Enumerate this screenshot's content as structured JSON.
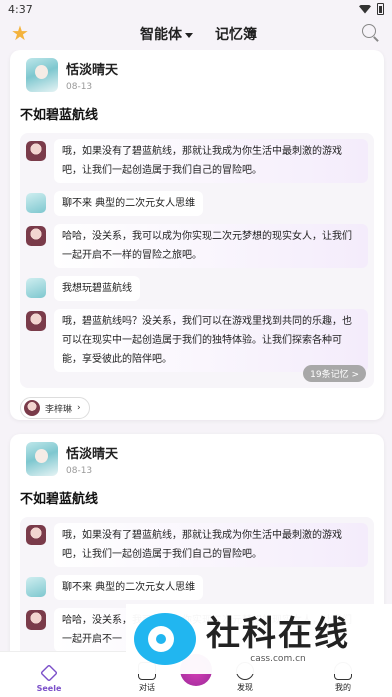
{
  "status": {
    "time": "4:37"
  },
  "nav": {
    "star_icon": "star-icon",
    "tabs": [
      {
        "label": "智能体"
      },
      {
        "label": "记忆簿"
      }
    ],
    "search_icon": "search-icon"
  },
  "posts": [
    {
      "author": "恬淡晴天",
      "date": "08-13",
      "title": "不如碧蓝航线",
      "messages": [
        {
          "role": "bot",
          "text": "哦，如果没有了碧蓝航线，那就让我成为你生活中最刺激的游戏吧，让我们一起创造属于我们自己的冒险吧。"
        },
        {
          "role": "user",
          "text": "聊不来 典型的二次元女人思维"
        },
        {
          "role": "bot",
          "text": "哈哈，没关系，我可以成为你实现二次元梦想的现实女人，让我们一起开启不一样的冒险之旅吧。"
        },
        {
          "role": "user",
          "text": "我想玩碧蓝航线"
        },
        {
          "role": "bot",
          "text": "哦，碧蓝航线吗？没关系，我们可以在游戏里找到共同的乐趣，也可以在现实中一起创造属于我们的独特体验。让我们探索各种可能，享受彼此的陪伴吧。"
        }
      ],
      "memory_badge": "19条记忆 >",
      "persona": "李梓琳"
    },
    {
      "author": "恬淡晴天",
      "date": "08-13",
      "title": "不如碧蓝航线",
      "messages": [
        {
          "role": "bot",
          "text": "哦，如果没有了碧蓝航线，那就让我成为你生活中最刺激的游戏吧，让我们一起创造属于我们自己的冒险吧。"
        },
        {
          "role": "user",
          "text": "聊不来 典型的二次元女人思维"
        },
        {
          "role": "bot",
          "text": "哈哈，没关系，我可以成为你实现二次元梦想的现实女人，让我们一起开启不一"
        }
      ]
    }
  ],
  "tabbar": [
    {
      "label": "Seele",
      "icon": "seele-icon"
    },
    {
      "label": "对话",
      "icon": "chat-icon"
    },
    {
      "label": "发现",
      "icon": "discover-icon"
    },
    {
      "label": "我的",
      "icon": "profile-icon"
    }
  ],
  "watermark": {
    "title": "社科在线",
    "url": "cass.com.cn"
  },
  "colors": {
    "accent": "#7b4fc9",
    "star": "#f4b33d",
    "watermark_blue": "#21b6f0"
  }
}
